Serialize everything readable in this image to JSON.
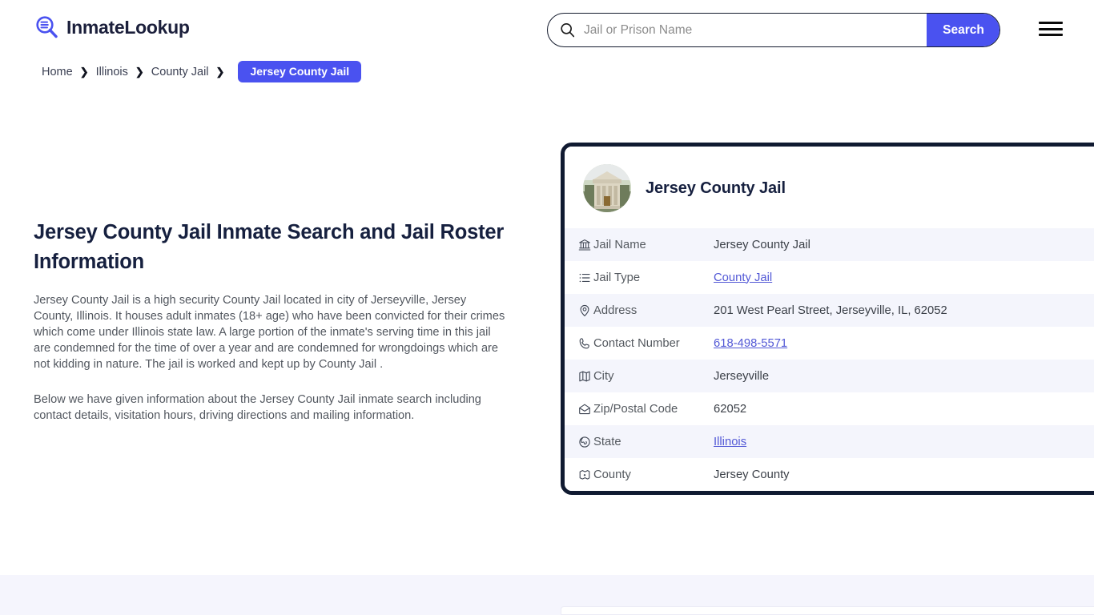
{
  "header": {
    "brand_name": "InmateLookup",
    "brand_icon": "magnifier-list-logo-icon",
    "search": {
      "placeholder": "Jail or Prison Name",
      "value": "",
      "button_label": "Search",
      "icon": "search-icon"
    },
    "menu_icon": "hamburger-menu-icon"
  },
  "breadcrumb": {
    "separator": "❯",
    "items": [
      {
        "label": "Home",
        "current": false
      },
      {
        "label": "Illinois",
        "current": false
      },
      {
        "label": "County Jail",
        "current": false
      }
    ],
    "current": "Jersey County Jail"
  },
  "main": {
    "title": "Jersey County Jail Inmate Search and Jail Roster Information",
    "paragraph_1": "Jersey County Jail is a high security County Jail located in city of Jerseyville, Jersey County, Illinois. It houses adult inmates (18+ age) who have been convicted for their crimes which come under Illinois state law. A large portion of the inmate's serving time in this jail are condemned for the time of over a year and are condemned for wrongdoings which are not kidding in nature. The jail is worked and kept up by County Jail .",
    "paragraph_2": "Below we have given information about the Jersey County Jail inmate search including contact details, visitation hours, driving directions and mailing information."
  },
  "card": {
    "thumbnail_icon": "courthouse-photo",
    "title": "Jersey County Jail",
    "rows": [
      {
        "icon": "bank-building-icon",
        "label": "Jail Name",
        "value": "Jersey County Jail",
        "link": false
      },
      {
        "icon": "list-icon",
        "label": "Jail Type",
        "value": "County Jail",
        "link": true
      },
      {
        "icon": "map-pin-icon",
        "label": "Address",
        "value": "201 West Pearl Street, Jerseyville, IL, 62052",
        "link": false
      },
      {
        "icon": "phone-icon",
        "label": "Contact Number",
        "value": "618-498-5571",
        "link": true
      },
      {
        "icon": "map-icon",
        "label": "City",
        "value": "Jerseyville",
        "link": false
      },
      {
        "icon": "envelope-open-icon",
        "label": "Zip/Postal Code",
        "value": "62052",
        "link": false
      },
      {
        "icon": "globe-icon",
        "label": "State",
        "value": "Illinois",
        "link": true
      },
      {
        "icon": "county-marker-icon",
        "label": "County",
        "value": "Jersey County",
        "link": false
      }
    ]
  },
  "colors": {
    "accent_blue": "#4A52F0",
    "link_blue": "#5258D6",
    "card_border": "#101A31",
    "heading": "#16203F",
    "body_text": "#52575F",
    "row_alt": "#F4F5FC",
    "footer_band": "#F5F5FD"
  }
}
